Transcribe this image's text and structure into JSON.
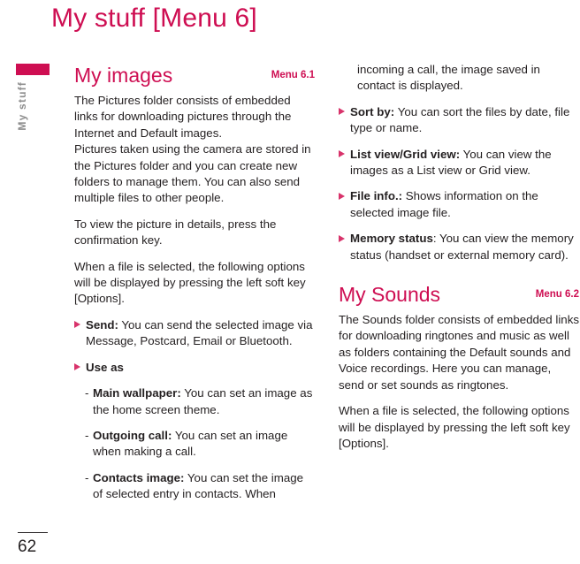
{
  "page": {
    "title": "My stuff [Menu 6]",
    "number": "62",
    "accent_color": "#ce0e52",
    "body_color": "#231f20",
    "sidebar_label_color": "#8d8d8d"
  },
  "sidebar": {
    "tab_label": "My stuff"
  },
  "sections": [
    {
      "id": "my-images",
      "title": "My images",
      "menu_ref": "Menu 6.1"
    },
    {
      "id": "my-sounds",
      "title": "My Sounds",
      "menu_ref": "Menu 6.2"
    }
  ],
  "left_column": {
    "paragraphs": [
      "The Pictures folder consists of embedded links for downloading pictures through the Internet and Default images.",
      "Pictures taken using the camera are stored in the Pictures folder and you can create new folders to manage them. You can also send multiple files to other people.",
      "To view the picture in details, press the confirmation key.",
      "When a file is selected, the following options will be displayed by pressing the left soft key [Options]."
    ],
    "bullets": [
      {
        "label": "Send:",
        "text": " You can send the selected image via Message, Postcard, Email or Bluetooth."
      },
      {
        "label": "Use as",
        "text": ""
      }
    ],
    "sub_items": [
      {
        "dash": "-",
        "label": "Main wallpaper:",
        "text": " You can set an image as the home screen theme."
      },
      {
        "dash": "-",
        "label": "Outgoing call:",
        "text": " You can set an image when making a call."
      },
      {
        "dash": "-",
        "label": "Contacts image:",
        "text": " You can set the image of selected entry in contacts. When"
      }
    ]
  },
  "right_column": {
    "continuation": "incoming a call, the image saved in contact is displayed.",
    "bullets": [
      {
        "label": "Sort by:",
        "text": " You can sort the files by date, file type or name."
      },
      {
        "label": "List view/Grid view:",
        "text": " You can view the images as a List view or Grid view."
      },
      {
        "label": "File info.:",
        "text": " Shows information on the selected image file."
      },
      {
        "label": "Memory status",
        "text": ": You can view the memory status (handset or external memory card)."
      }
    ],
    "paragraphs": [
      "The Sounds folder consists of embedded links for downloading ringtones and music as well as folders containing the Default sounds and Voice recordings. Here you can manage, send or set sounds as ringtones.",
      "When a file is selected, the following options will be displayed by pressing the left soft key [Options]."
    ]
  }
}
